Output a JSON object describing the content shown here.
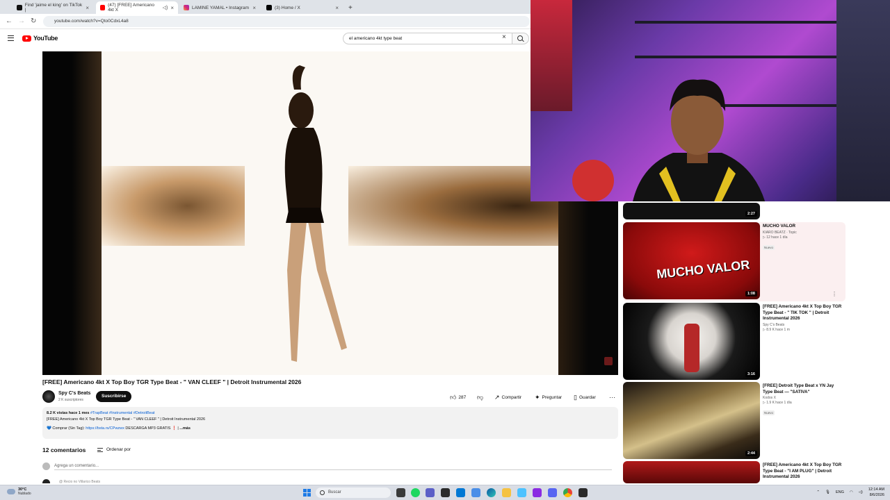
{
  "browser": {
    "tabs": [
      {
        "label": "Find 'jaime el king' on TikTok |",
        "active": false
      },
      {
        "label": "(47) [FREE] Americano 4kt X",
        "active": true
      },
      {
        "label": "LAMINE YAMAL • Instagram",
        "active": false
      },
      {
        "label": "(3) Home / X",
        "active": false
      }
    ],
    "url": "youtube.com/watch?v=Qto0CdxL4a8"
  },
  "youtube": {
    "logo_text": "YouTube",
    "search_value": "el americano 4kt type beat"
  },
  "video": {
    "title": "[FREE] Americano 4kt X Top Boy TGR Type Beat - \" VAN CLEEF \" | Detroit Instrumental 2026",
    "channel_name": "Spy C's Beats",
    "channel_subs": "2 K suscriptores",
    "subscribe_label": "Suscribirse",
    "likes": "287",
    "share_label": "Compartir",
    "ask_label": "Preguntar",
    "save_label": "Guardar",
    "description": {
      "meta": "8.2 K vistas  hace 1 mes",
      "tags": "#TrapBeat #Instrumental #DetroitBeat",
      "line1": "[FREE] Americano 4kt X Top Boy TGR Type Beat - \" VAN CLEEF \" | Detroit Instrumental 2026",
      "buy_prefix": "💙 Comprar (Sin Tag): ",
      "buy_link": "https://bsta.rs/CPwzwx",
      "buy_suffix": " DESCARGA MP3 GRATIS ❗ |",
      "more": "...más"
    }
  },
  "comments": {
    "title": "12 comentarios",
    "sort_label": "Ordenar por",
    "input_placeholder": "Agrega un comentario...",
    "next_author": "@ Recio no Villarico Beats"
  },
  "recommendations": [
    {
      "title": "",
      "channel": "",
      "meta": "",
      "badge": "",
      "duration": "2:27"
    },
    {
      "title": "MUCHO VALOR",
      "channel": "KIARO BEATZ · Topic",
      "meta": "▷ 12  hace 1 día",
      "badge": "Nuevo",
      "duration": "1:08",
      "thumb_text": "MUCHO VALOR"
    },
    {
      "title": "[FREE] Americano 4kt X Top Boy TGR Type Beat - \" TIK TOK \" | Detroit Instrumental 2026",
      "channel": "Spy C's Beats",
      "meta": "▷ 8.9 K  hace 1 m",
      "badge": "",
      "duration": "3:16"
    },
    {
      "title": "[FREE] Detroit Type Beat x YN Jay Type Beat — \"SATIVA\"",
      "channel": "Kodos X",
      "meta": "▷ 1.9 K  hace 1 día",
      "badge": "Nuevo",
      "duration": "2:44"
    },
    {
      "title": "[FREE] Americano 4kt X Top Boy TGR Type Beat - \"I AM PLUG\" | Detroit Instrumental 2026",
      "channel": "",
      "meta": "",
      "badge": "",
      "duration": ""
    }
  ],
  "taskbar": {
    "weather_temp": "30°C",
    "weather_cond": "Nublado",
    "search_label": "Buscar",
    "lang": "ENG",
    "time": "12:14 AM",
    "date": "8/6/2026"
  },
  "colors": {
    "accent_red": "#ff0000",
    "link_blue": "#065fd4",
    "windows_blue": "#1e7be6"
  }
}
